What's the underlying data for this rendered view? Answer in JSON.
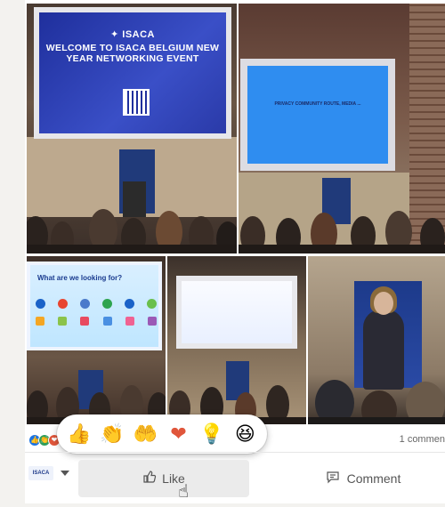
{
  "photos": {
    "p1": {
      "logo": "✦ ISACA",
      "slide_text": "WELCOME TO ISACA BELGIUM NEW YEAR NETWORKING EVENT"
    },
    "p2": {
      "slide_text": "PRIVACY COMMUNITY ROUTE, MEDIA ..."
    },
    "p3": {
      "slide_title": "What are we looking for?"
    },
    "p4": {},
    "p5": {}
  },
  "reactions": {
    "picker": [
      {
        "name": "like",
        "glyph": "👍"
      },
      {
        "name": "celebrate",
        "glyph": "👏"
      },
      {
        "name": "support",
        "glyph": "🤲"
      },
      {
        "name": "love",
        "glyph": "❤"
      },
      {
        "name": "insightful",
        "glyph": "💡"
      },
      {
        "name": "funny",
        "glyph": "😆"
      }
    ],
    "summary_colors": [
      "#1b74e4",
      "#2e9e5b",
      "#e0563b"
    ]
  },
  "comments_count": "1 commen",
  "actions": {
    "like_label": "Like",
    "comment_label": "Comment",
    "actor_logo": "ISACA"
  },
  "colors": {
    "accent_blue": "#1b74e4",
    "like_bg": "#ebebeb"
  }
}
